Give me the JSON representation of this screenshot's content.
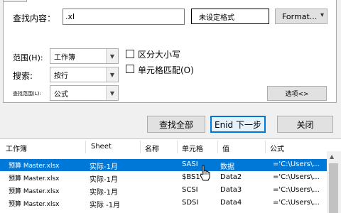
{
  "find": {
    "label": "查找内容：",
    "value": ".xl",
    "format_preview": "未设定格式",
    "format_button": "Format...",
    "format_arrow": "▾"
  },
  "options": {
    "scope_label": "范围(H):",
    "scope_value": "工作簿",
    "search_label": "搜索:",
    "search_value": "按行",
    "lookin_label": "查找范围(L):",
    "lookin_value": "公式",
    "match_case": "区分大小写",
    "match_entire": "单元格匹配(O)",
    "options_button": "选项<>"
  },
  "actions": {
    "find_all": "查找全部",
    "find_next": "Enid 下一步",
    "close": "关闭"
  },
  "results": {
    "headers": [
      "工作簿",
      "Sheet",
      "名称",
      "单元格",
      "值",
      "公式"
    ],
    "rows": [
      [
        "预算 Master.xlsx",
        "实际-1月",
        "",
        "SASI",
        "数据",
        "='C:\\Users\\..."
      ],
      [
        "预算 Master.xlsx",
        "实际-1月",
        "",
        "$BS1",
        "Data2",
        "='C:\\Users\\..."
      ],
      [
        "预算 Master.xlsx",
        "实际-1月",
        "",
        "SCSI",
        "Data3",
        "='C:\\Users\\..."
      ],
      [
        "预算 Master.xlsx",
        "实际 -1月",
        "",
        "SDSI",
        "Data4",
        "='C:\\Users\\..."
      ]
    ]
  },
  "colors": {
    "selection": "#0078d7",
    "accent_border": "#0078d7"
  },
  "icons": {
    "cursor": "hand-pointer-icon",
    "dropdown": "chevron-down-icon"
  }
}
